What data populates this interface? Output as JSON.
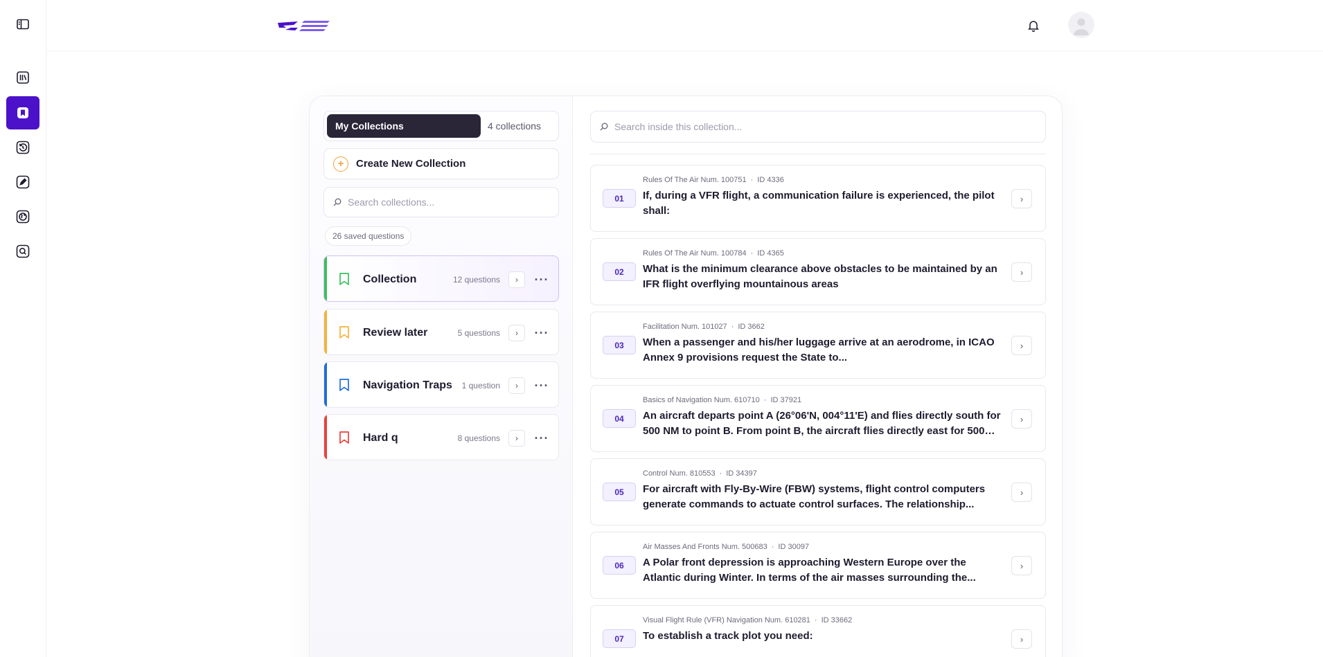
{
  "header": {
    "notification_icon": "bell-icon",
    "avatar_icon": "user-icon"
  },
  "rail": {
    "items": [
      {
        "icon": "sidebar-toggle-icon"
      },
      {
        "icon": "library-icon"
      },
      {
        "icon": "bookmark-icon",
        "active": true
      },
      {
        "icon": "history-icon"
      },
      {
        "icon": "pen-icon"
      },
      {
        "icon": "globe-icon"
      },
      {
        "icon": "search-icon"
      }
    ]
  },
  "collections_panel": {
    "tab_active": "My Collections",
    "tab_count": "4 collections",
    "create_label": "Create New Collection",
    "create_icon": "+",
    "search_placeholder": "Search collections...",
    "saved_badge": "26 saved questions",
    "items": [
      {
        "name": "Collection",
        "count": "12 questions",
        "color": "#3cbf5c",
        "selected": true
      },
      {
        "name": "Review later",
        "count": "5 questions",
        "color": "#f5b23d"
      },
      {
        "name": "Navigation Traps",
        "count": "1 question",
        "color": "#1f6fd6"
      },
      {
        "name": "Hard q",
        "count": "8 questions",
        "color": "#e8413a"
      }
    ],
    "arrow_glyph": "›",
    "more_glyph": "···"
  },
  "questions_panel": {
    "search_placeholder": "Search inside this collection...",
    "arrow_glyph": "›",
    "items": [
      {
        "num": "01",
        "subject": "Rules Of The Air Num. 100751",
        "id": "ID 4336",
        "title": "If, during a VFR flight, a communication failure is experienced, the pilot shall:"
      },
      {
        "num": "02",
        "subject": "Rules Of The Air Num. 100784",
        "id": "ID 4365",
        "title": "What is the minimum clearance above obstacles to be maintained by an IFR flight overflying mountainous areas"
      },
      {
        "num": "03",
        "subject": "Facilitation Num. 101027",
        "id": "ID 3662",
        "title": "When a passenger and his/her luggage arrive at an aerodrome, in ICAO Annex 9 provisions request the State to..."
      },
      {
        "num": "04",
        "subject": "Basics of Navigation Num. 610710",
        "id": "ID 37921",
        "title": "An aircraft departs point A (26°06'N, 004°11'E) and flies directly south for 500 NM to point B. From point B, the aircraft flies directly east for 500 N..."
      },
      {
        "num": "05",
        "subject": "Control Num. 810553",
        "id": "ID 34397",
        "title": "For aircraft with Fly-By-Wire (FBW) systems, flight control computers generate commands to actuate control surfaces. The relationship..."
      },
      {
        "num": "06",
        "subject": "Air Masses And Fronts Num. 500683",
        "id": "ID 30097",
        "title": "A Polar front depression is approaching Western Europe over the Atlantic during Winter. In terms of the air masses surrounding the..."
      },
      {
        "num": "07",
        "subject": "Visual Flight Rule (VFR) Navigation Num. 610281",
        "id": "ID 33662",
        "title": "To establish a track plot you need:"
      }
    ]
  }
}
